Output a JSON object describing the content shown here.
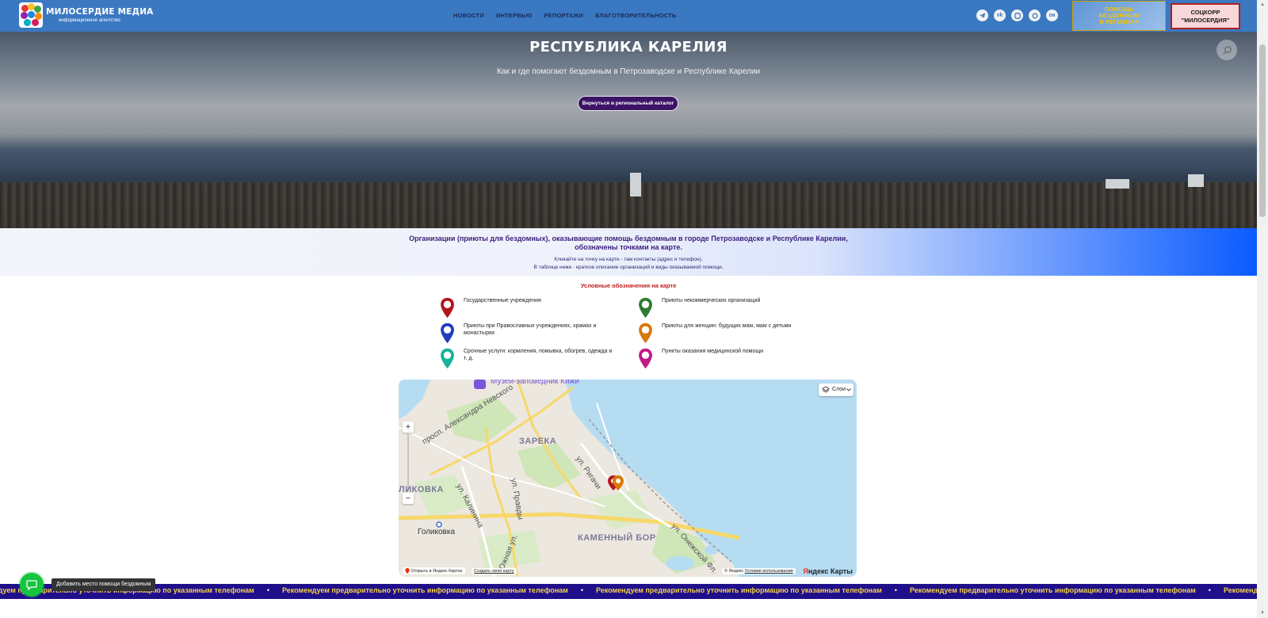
{
  "site": {
    "logo_title": "МИЛОСЕРДИЕ МЕДИА",
    "logo_subtitle": "информационное агентство"
  },
  "nav": [
    "НОВОСТИ",
    "ИНТЕРВЬЮ",
    "РЕПОРТАЖИ",
    "БЛАГОТВОРИТЕЛЬНОСТЬ"
  ],
  "socials": [
    "telegram",
    "vk",
    "rutube",
    "dzen",
    "odnoklassniki"
  ],
  "header_buttons": {
    "regions": [
      "ПОМОЩЬ",
      "БЕЗДОМНЫМ",
      "В РЕГИОНАХ"
    ],
    "socorp": [
      "СОЦКОРР",
      "\"МИЛОСЕРДИЯ\""
    ]
  },
  "hero": {
    "title": "РЕСПУБЛИКА КАРЕЛИЯ",
    "subtitle": "Как и где помогают бездомным в Петрозаводске и Республике Карелии",
    "button": "Вернуться в региональный каталог"
  },
  "intro": {
    "heading_line1": "Организации (приюты для бездомных), оказывающие помощь бездомным в городе Петрозаводске и Республике Карелии,",
    "heading_line2": "обозначены точками на карте.",
    "line1": "Кликайте на точку на карте - там контакты (адрес и телефон).",
    "line2": "В таблице ниже - краткое описание организаций и виды оказываемой помощи."
  },
  "legend": {
    "title": "Условные обозначения на карте",
    "items": [
      {
        "label": "Государственные учреждения",
        "color": "#b3161b"
      },
      {
        "label": "Приюты некоммерческих организаций",
        "color": "#2e7d32"
      },
      {
        "label": "Приюты при Православных учреждениях, храмах и монастырях",
        "color": "#1f3fbf"
      },
      {
        "label": "Приюты для женщин: будущих мам, мам с детьми",
        "color": "#d9780b"
      },
      {
        "label": "Срочные услуги: кормления, помывка, обогрев, одежда и т. д.",
        "color": "#15b39a"
      },
      {
        "label": "Пункты оказания медицинской помощи",
        "color": "#c01a86"
      }
    ]
  },
  "map": {
    "layers_label": "Слои",
    "labels": {
      "poi": "Музей-заповедник Кижи",
      "district_zareka": "ЗАРЕКА",
      "district_golikovka_upper": "ЛИКОВКА",
      "district_kamenny_bor": "КАМЕННЫЙ БОР",
      "place_golikovka": "Голиковка",
      "street_nevsky": "просп. Александра Невского",
      "street_kalinina": "ул. Калинина",
      "street_pravdy": "ул. Правды",
      "street_rigacheva": "ул. Ригачи",
      "street_onezhskoy": "ул. Онежской Фл.",
      "street_yuzhnaya": "Южная ул."
    },
    "open_in_yandex": "Открыть в Яндекс Картах",
    "create_map": "Создать свою карту",
    "copyright": "© Яндекс",
    "terms": "Условия использования",
    "brand_y": "Я",
    "brand_rest": "ндекс Карты"
  },
  "ticker": {
    "text": "Рекомендуем предварительно уточнить информацию по указанным телефонам"
  },
  "chat": {
    "tooltip": "Добавить место помощи бездомным"
  }
}
